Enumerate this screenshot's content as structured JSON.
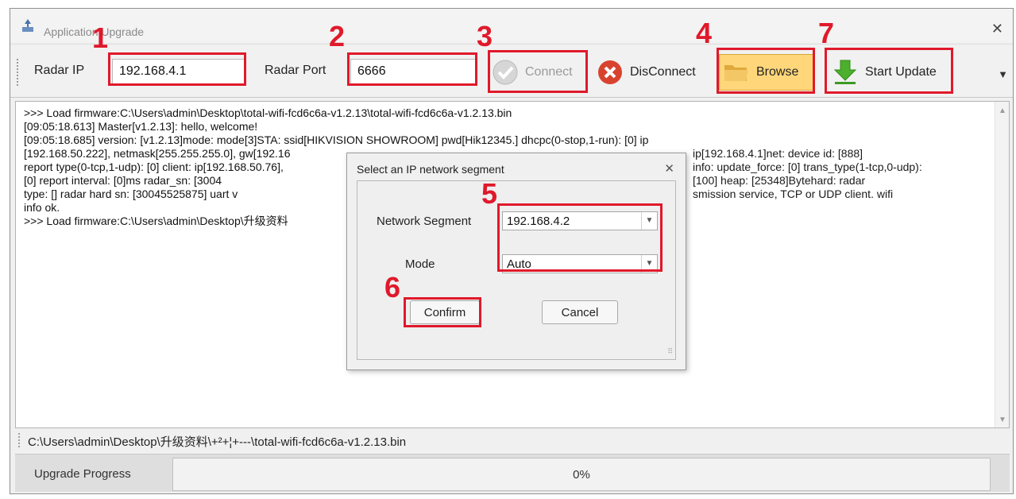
{
  "window": {
    "title": "Application Upgrade"
  },
  "toolbar": {
    "radar_ip_label": "Radar IP",
    "radar_ip_value": "192.168.4.1",
    "radar_port_label": "Radar Port",
    "radar_port_value": "6666",
    "connect_label": "Connect",
    "disconnect_label": "DisConnect",
    "browse_label": "Browse",
    "start_update_label": "Start Update"
  },
  "annotations": [
    "1",
    "2",
    "3",
    "4",
    "7",
    "5",
    "6"
  ],
  "log": {
    "lines": [
      ">>> Load firmware:C:\\Users\\admin\\Desktop\\total-wifi-fcd6c6a-v1.2.13\\total-wifi-fcd6c6a-v1.2.13.bin",
      "[09:05:18.613] Master[v1.2.13]: hello, welcome!",
      "[09:05:18.685] version:        [v1.2.13]mode:     mode[3]STA:          ssid[HIKVISION SHOWROOM]  pwd[Hik12345.]     dhcpc(0-stop,1-run): [0]        ip",
      "[192.168.50.222], netmask[255.255.255.0], gw[192.16",
      "report type(0-tcp,1-udp): [0] client: ip[192.168.50.76],",
      "[0]       report interval: [0]ms          radar_sn: [3004",
      "type: []   radar hard sn: [30045525875]              uart v",
      "info ok.",
      ">>> Load firmware:C:\\Users\\admin\\Desktop\\升级资料"
    ],
    "right_fragments": [
      "ip[192.168.4.1]net:              device id: [888]",
      "info: update_force: [0]  trans_type(1-tcp,0-udp):",
      "[100]              heap: [25348]Bytehard:           radar",
      "smission service, TCP or UDP client.                   wifi"
    ]
  },
  "path_bar": {
    "text": "C:\\Users\\admin\\Desktop\\升级资料\\+²+¦+---\\total-wifi-fcd6c6a-v1.2.13.bin"
  },
  "progress": {
    "label": "Upgrade Progress",
    "text": "0%",
    "value": 0
  },
  "dialog": {
    "title": "Select an IP network segment",
    "network_segment_label": "Network Segment",
    "network_segment_value": "192.168.4.2",
    "mode_label": "Mode",
    "mode_value": "Auto",
    "confirm_label": "Confirm",
    "cancel_label": "Cancel"
  },
  "colors": {
    "annotation_red": "#e0192b",
    "browse_highlight": "#ffd77a",
    "progress_fill": "#6fcf4a"
  }
}
